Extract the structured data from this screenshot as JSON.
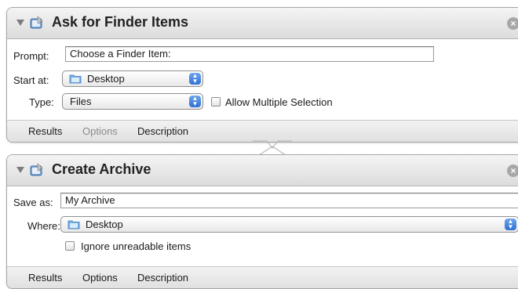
{
  "actions": [
    {
      "title": "Ask for Finder Items",
      "prompt_label": "Prompt:",
      "prompt_value": "Choose a Finder Item:",
      "start_label": "Start at:",
      "start_value": "Desktop",
      "type_label": "Type:",
      "type_value": "Files",
      "allow_multiple_label": "Allow Multiple Selection",
      "allow_multiple_checked": false,
      "tabs": [
        "Results",
        "Options",
        "Description"
      ],
      "dim_tab": "Options"
    },
    {
      "title": "Create Archive",
      "save_label": "Save as:",
      "save_value": "My Archive",
      "where_label": "Where:",
      "where_value": "Desktop",
      "ignore_label": "Ignore unreadable items",
      "ignore_checked": false,
      "tabs": [
        "Results",
        "Options",
        "Description"
      ]
    }
  ],
  "icons": {
    "disclosure": "disclosure-triangle-icon",
    "app": "automator-finder-icon",
    "close": "close-icon",
    "folder": "folder-icon",
    "popup_arrows": "popup-arrows-icon"
  },
  "colors": {
    "accent_blue": "#2f6fd6",
    "header_gray": "#dcdcdc"
  }
}
